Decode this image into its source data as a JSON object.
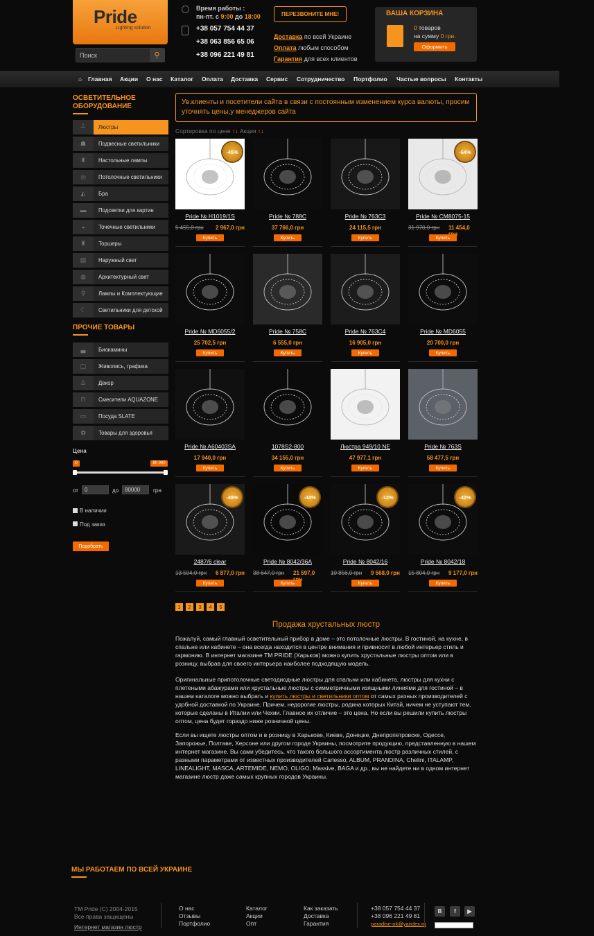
{
  "header": {
    "logo_text": "Pride",
    "logo_sub": "Lighting solution",
    "search_placeholder": "Поиск",
    "hours_label": "Время работы :",
    "hours_days": "пн-пт. с",
    "hours_from": "9:00",
    "hours_to_word": "до",
    "hours_to": "18:00",
    "phones": [
      "+38 057 754 44 37",
      "+38 063 856 65 06",
      "+38 096 221 49 81"
    ],
    "callback_label": "ПЕРЕЗВОНИТЕ МНЕ!",
    "features": [
      {
        "link": "Доставка",
        "text": " по всей Украине"
      },
      {
        "link": "Оплата",
        "text": " любым способом"
      },
      {
        "link": "Гарантия",
        "text": " для всех клиентов"
      }
    ],
    "cart": {
      "title": "ВАША КОРЗИНА",
      "count": "0",
      "count_label": " товаров",
      "sum_label": "на сумму ",
      "sum": "0 грн.",
      "checkout": "Оформить"
    }
  },
  "nav": [
    "Главная",
    "Акции",
    "О нас",
    "Каталог",
    "Оплата",
    "Доставка",
    "Сервис",
    "Сотрудничество",
    "Портфолио",
    "Частые вопросы",
    "Контакты"
  ],
  "sidebar": {
    "heading1": "ОСВЕТИТЕЛЬНОЕ ОБОРУДОВАНИЕ",
    "cat1": [
      "Люстры",
      "Подвесные светильники",
      "Настольные лампы",
      "Потолочные светильники",
      "Бра",
      "Подсветки для картин",
      "Точечные светильники",
      "Торшеры",
      "Наружный свет",
      "Архитектурный свет",
      "Лампы и Комплектующие",
      "Светильники для детской"
    ],
    "heading2": "ПРОЧИЕ ТОВАРЫ",
    "cat2": [
      "Биокамины",
      "Живопись, графика",
      "Декор",
      "Смесители AQUAZONE",
      "Посуда SLATE",
      "Товары для здоровья"
    ],
    "price_label": "Цена",
    "price_min": "0",
    "price_max": "80 000",
    "from_label": "от",
    "from_value": "0",
    "to_label": "до",
    "to_value": "80000",
    "currency": "грн",
    "in_stock": "В наличии",
    "on_order": "Под заказ",
    "apply": "Подобрать"
  },
  "notice": "Ув.клиенты и посетители сайта в связи с постоянным изменением курса валюты, просим уточнять цены,у менеджеров сайта",
  "sort": {
    "label": "Сортировка по цене",
    "action": "Акция"
  },
  "products": [
    {
      "name": "Pride № H1019/1S",
      "old": "5 455,0 грн",
      "price": "2 967,0 грн",
      "badge": "-45%",
      "bg": "#ffffff"
    },
    {
      "name": "Pride № 788C",
      "old": "",
      "price": "37 766,0 грн",
      "badge": "",
      "bg": "#0d0d0d"
    },
    {
      "name": "Pride № 763C3",
      "old": "",
      "price": "24 115,5 грн",
      "badge": "",
      "bg": "#181818"
    },
    {
      "name": "Pride № CM8075-15",
      "old": "31 970,0 грн",
      "price": "11 454,0 грн",
      "badge": "-64%",
      "bg": "#e9e9e9"
    },
    {
      "name": "Pride № MD6055/2",
      "old": "",
      "price": "25 702,5 грн",
      "badge": "",
      "bg": "#0d0d0d"
    },
    {
      "name": "Pride № 758C",
      "old": "",
      "price": "6 555,0 грн",
      "badge": "",
      "bg": "#2a2a2a"
    },
    {
      "name": "Pride № 763C4",
      "old": "",
      "price": "16 905,0 грн",
      "badge": "",
      "bg": "#1c1c1c"
    },
    {
      "name": "Pride № MD6055",
      "old": "",
      "price": "20 700,0 грн",
      "badge": "",
      "bg": "#0d0d0d"
    },
    {
      "name": "Pride № A60403SA",
      "old": "",
      "price": "17 940,0 грн",
      "badge": "",
      "bg": "#101010"
    },
    {
      "name": "1078S2-800",
      "old": "",
      "price": "34 155,0 грн",
      "badge": "",
      "bg": "#0b0b0b"
    },
    {
      "name": "Люстра 949/10 NE",
      "old": "",
      "price": "47 977,1 грн",
      "badge": "",
      "bg": "#f2f2f2"
    },
    {
      "name": "Pride № 763S",
      "old": "",
      "price": "58 477,5 грн",
      "badge": "",
      "bg": "#5b6166"
    },
    {
      "name": "2487/6 clear",
      "old": "",
      "price": "",
      "badge": "-49%",
      "bg": "#1a1a1a"
    },
    {
      "name": "Pride № 8042/36A",
      "old": "38 647,0 грн",
      "price": "21 597,0 грн",
      "badge": "-44%",
      "bg": "#0a0a0a"
    },
    {
      "name": "Pride № 8042/16",
      "old": "10 856,0 грн",
      "price": "9 568,0 грн",
      "badge": "-12%",
      "bg": "#0d0d0d"
    },
    {
      "name": "Pride № 8042/18",
      "old": "15 804,0 грн",
      "price": "9 177,0 грн",
      "badge": "-42%",
      "bg": "#0d0d0d"
    }
  ],
  "product_extra": {
    "p12_old": "13 504,0 грн",
    "p12_price": "6 877,0 грн"
  },
  "buy_label": "Купить",
  "pages": [
    "1",
    "2",
    "3",
    "4",
    "5"
  ],
  "seo": {
    "title": "Продажа хрустальных люстр",
    "p1": "Пожалуй, самый главный осветительный прибор в доме – это потолочные люстры. В гостиной, на кухне, в спальне или кабинете – она всегда находится в центре внимания и привносит в любой интерьер стиль и гармонию. В интернет магазине ТМ PRIDE (Харьков) можно купить хрустальные люстры оптом или в розницу, выбрав для своего интерьера наиболее подходящую модель.",
    "p2a": "Оригинальные припотолочные светодиодные люстры для спальни или кабинета, люстры для кухни с плетеными абажурами или хрустальные люстры с симметричными изящными линиями для гостиной – в нашем каталоге можно выбрать и ",
    "p2link": "купить люстры и светильники оптом",
    "p2b": " от самых разных производителей с удобной доставкой по Украине. Причем, недорогие люстры, родина которых Китай, ничем не уступают тем, которые сделаны в Италии или Чехии. Главное их отличие – это цена. Но если вы решили купить люстры оптом, цена будет гораздо ниже розничной цены.",
    "p3": "Если вы ищете люстры оптом и в розницу в Харькове, Киеве, Донецке, Днепропетровске, Одессе, Запорожье, Полтаве, Херсоне или другом городе Украины, посмотрите продукцию, представленную в нашем интернет магазине. Вы сами убедитесь, что такого большого ассортимента люстр различных стилей, с разными параметрами от известных производителей Carlesso, ALBUM, PRANDINA, Chelini, ITALAMP, LINEALIGHT, MASCA, ARTEMIDE, NEMO, OLIGO, Massive, BAGA и др., вы не найдете ни в одном интернет магазине люстр даже самых крупных городов Украины."
  },
  "ua_title": "МЫ РАБОТАЕМ ПО ВСЕЙ УКРАИНЕ",
  "footer": {
    "copy1": "TM Pride (C) 2004-2015",
    "copy2": "Все права защищены",
    "shop_link": "Интернет магазин люстр",
    "col1": [
      "О нас",
      "Отзывы",
      "Портфолио"
    ],
    "col2": [
      "Каталог",
      "Акции",
      "Опт"
    ],
    "col3": [
      "Как заказать",
      "Доставка",
      "Гарантия"
    ],
    "phones": [
      "+38 057 754 44 37",
      "+38 096 221 49 81"
    ],
    "email": "paradise-ok@yandex.ru",
    "social": [
      "B",
      "f",
      "▶"
    ]
  },
  "colors": {
    "accent": "#f7941d",
    "background": "#0b0b0b"
  }
}
